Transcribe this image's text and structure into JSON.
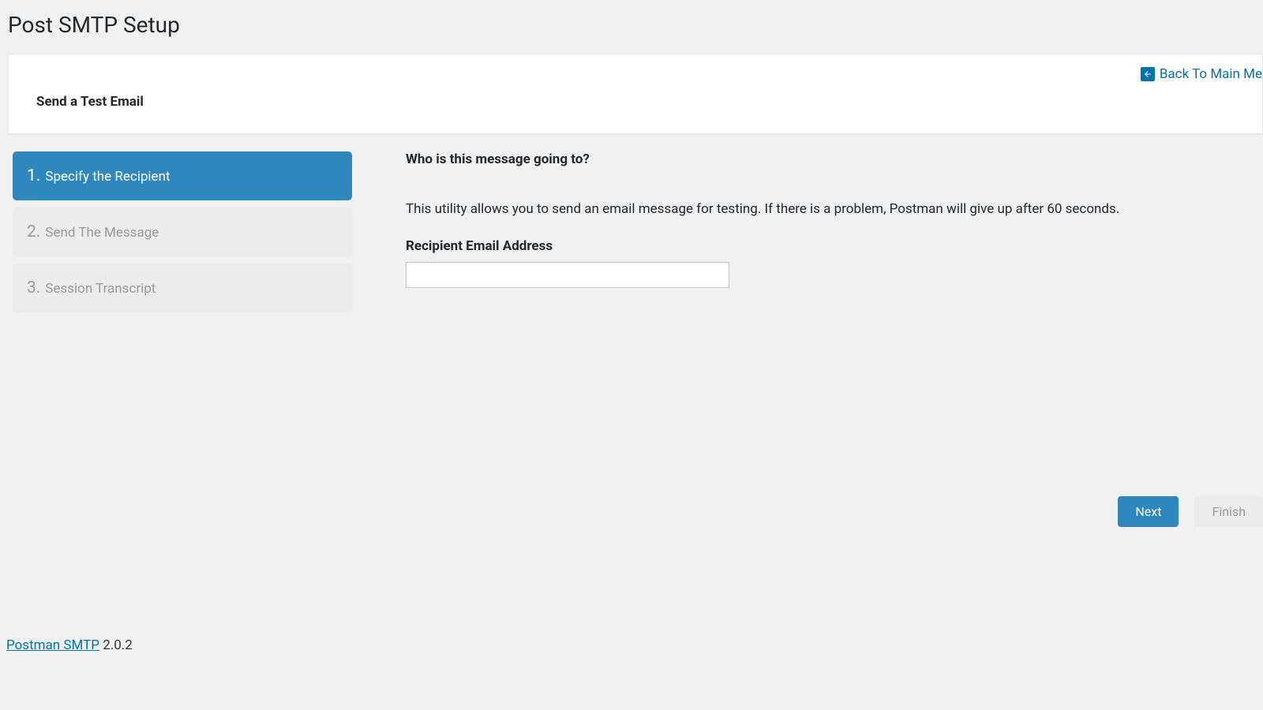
{
  "page": {
    "title": "Post SMTP Setup"
  },
  "header": {
    "heading": "Send a Test Email",
    "back_link_label": "Back To Main Me"
  },
  "steps": [
    {
      "number": "1.",
      "label": "Specify the Recipient",
      "active": true
    },
    {
      "number": "2.",
      "label": "Send The Message",
      "active": false
    },
    {
      "number": "3.",
      "label": "Session Transcript",
      "active": false
    }
  ],
  "content": {
    "heading": "Who is this message going to?",
    "description": "This utility allows you to send an email message for testing. If there is a problem, Postman will give up after 60 seconds.",
    "field_label": "Recipient Email Address",
    "field_value": ""
  },
  "buttons": {
    "next": "Next",
    "finish": "Finish"
  },
  "footer": {
    "link_label": "Postman SMTP",
    "version": " 2.0.2"
  }
}
